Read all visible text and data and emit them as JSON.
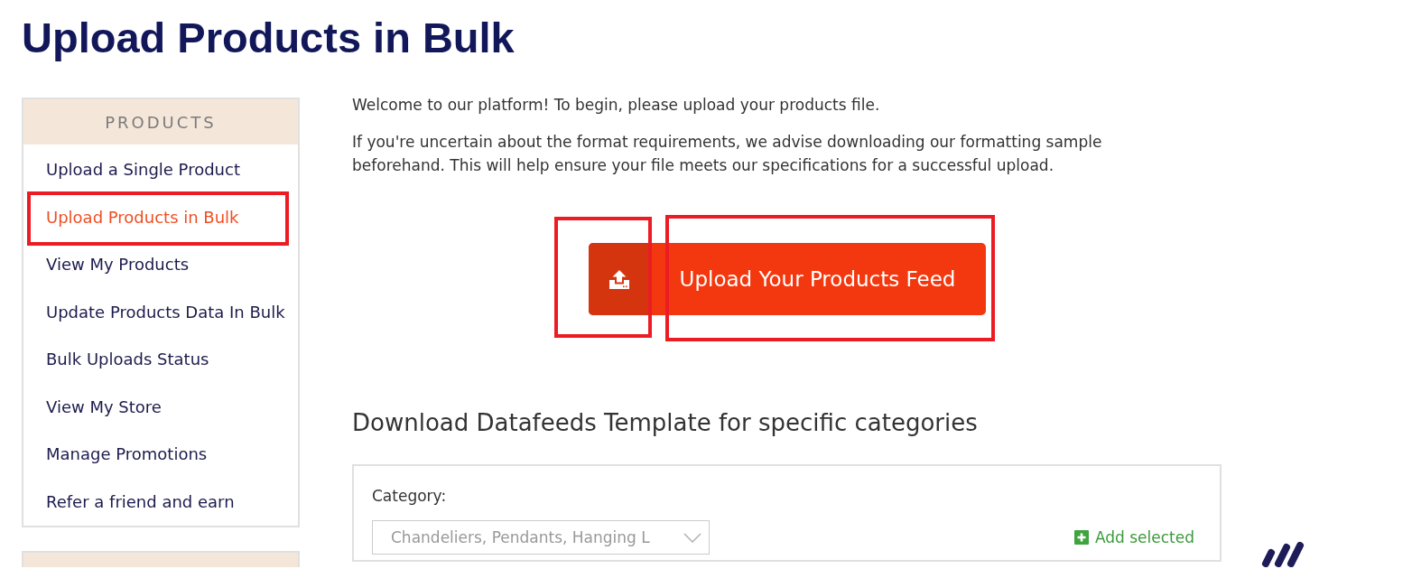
{
  "page_title": "Upload Products in Bulk",
  "sidebar": {
    "heading": "PRODUCTS",
    "items": [
      {
        "label": "Upload a Single Product",
        "selected": false,
        "highlighted": false
      },
      {
        "label": "Upload Products in Bulk",
        "selected": true,
        "highlighted": true
      },
      {
        "label": "View My Products",
        "selected": false,
        "highlighted": false
      },
      {
        "label": "Update Products Data In Bulk",
        "selected": false,
        "highlighted": false
      },
      {
        "label": "Bulk Uploads Status",
        "selected": false,
        "highlighted": false
      },
      {
        "label": "View My Store",
        "selected": false,
        "highlighted": false
      },
      {
        "label": "Manage Promotions",
        "selected": false,
        "highlighted": false
      },
      {
        "label": "Refer a friend and earn",
        "selected": false,
        "highlighted": false
      }
    ]
  },
  "intro": [
    "Welcome to our platform! To begin, please upload your products file.",
    "If you're uncertain about the format requirements, we advise downloading our formatting sample beforehand. This will help ensure your file meets our specifications for a successful upload."
  ],
  "upload_button": {
    "label": "Upload Your Products Feed",
    "icon_highlighted": true,
    "label_highlighted": true
  },
  "template_section": {
    "heading": "Download Datafeeds Template for specific categories",
    "category_label": "Category:",
    "category_select": {
      "value": "Chandeliers, Pendants, Hanging L"
    },
    "add_link": "Add selected"
  }
}
